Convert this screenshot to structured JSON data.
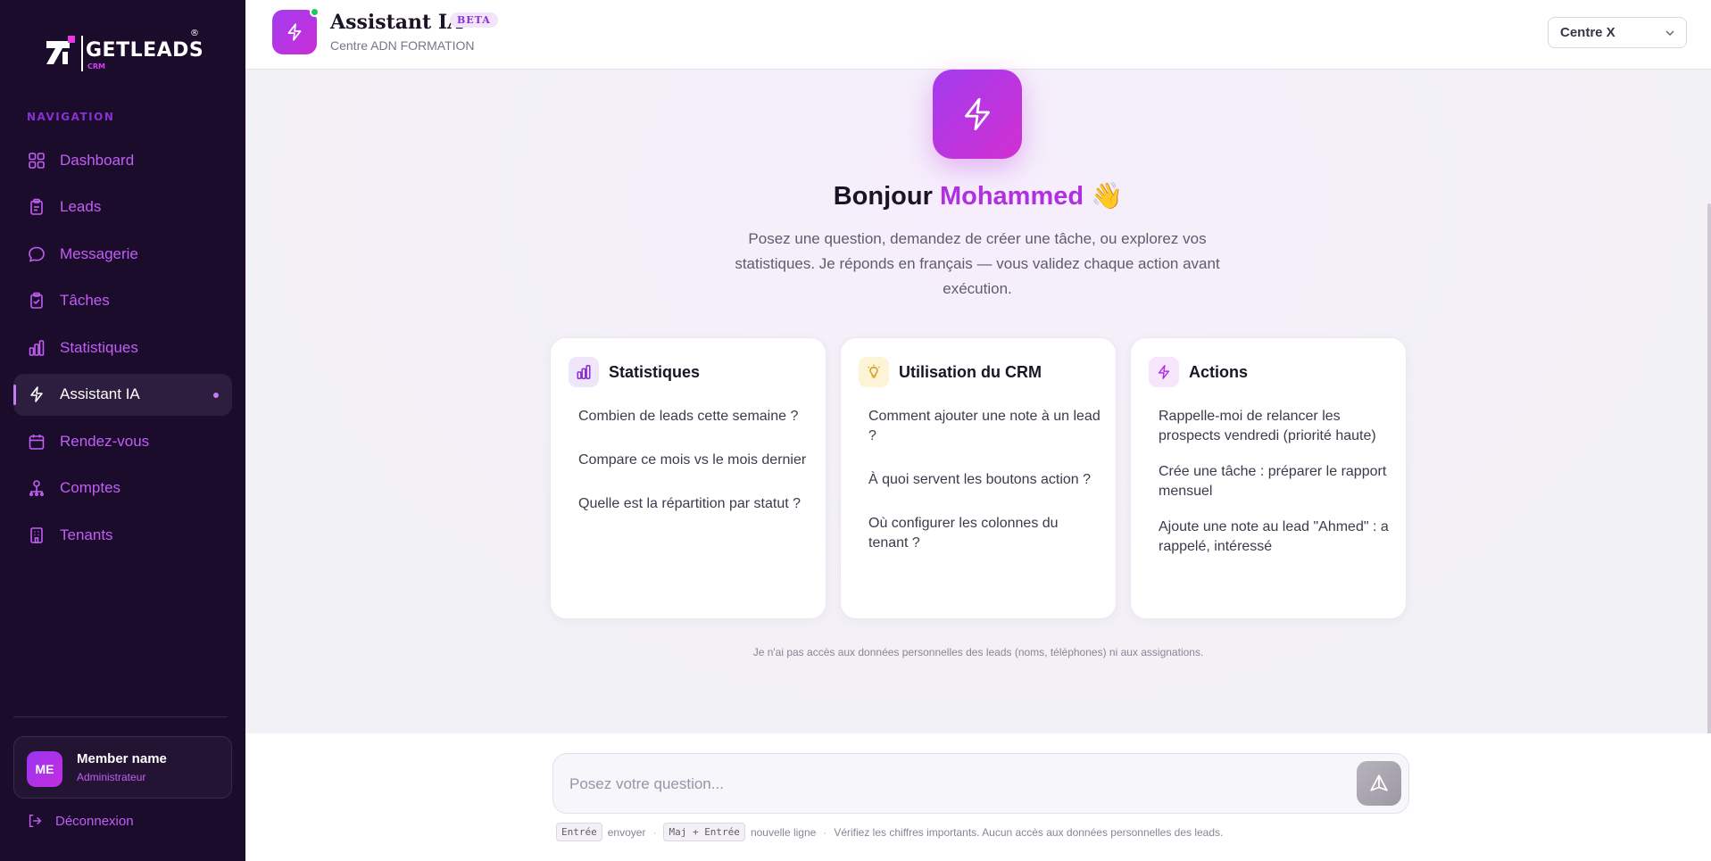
{
  "brand": {
    "name": "GETLEADS",
    "sub": "CRM",
    "registered": "®"
  },
  "sidebar": {
    "section_title": "NAVIGATION",
    "items": [
      {
        "label": "Dashboard",
        "icon": "grid-icon"
      },
      {
        "label": "Leads",
        "icon": "clipboard-icon"
      },
      {
        "label": "Messagerie",
        "icon": "chat-bubble-icon"
      },
      {
        "label": "Tâches",
        "icon": "clipboard-check-icon"
      },
      {
        "label": "Statistiques",
        "icon": "bar-chart-icon"
      },
      {
        "label": "Assistant IA",
        "icon": "lightning-icon",
        "active": true
      },
      {
        "label": "Rendez-vous",
        "icon": "calendar-icon"
      },
      {
        "label": "Comptes",
        "icon": "user-network-icon"
      },
      {
        "label": "Tenants",
        "icon": "building-icon"
      }
    ],
    "user": {
      "initials": "ME",
      "name": "Member name",
      "role": "Administrateur"
    },
    "logout_label": "Déconnexion"
  },
  "header": {
    "title": "Assistant IA",
    "badge": "BETA",
    "subtitle": "Centre ADN FORMATION",
    "center_select": "Centre X"
  },
  "main": {
    "greeting_prefix": "Bonjour",
    "greeting_name": "Mohammed",
    "greeting_emoji": "👋",
    "intro": "Posez une question, demandez de créer une tâche, ou explorez vos statistiques. Je réponds en français — vous validez chaque action avant exécution.",
    "cards": [
      {
        "title": "Statistiques",
        "icon": "bar-chart-icon",
        "questions": [
          "Combien de leads cette semaine ?",
          "Compare ce mois vs le mois dernier",
          "Quelle est la répartition par statut ?"
        ]
      },
      {
        "title": "Utilisation du CRM",
        "icon": "lightbulb-icon",
        "questions": [
          "Comment ajouter une note à un lead ?",
          "À quoi servent les boutons action ?",
          "Où configurer les colonnes du tenant ?"
        ]
      },
      {
        "title": "Actions",
        "icon": "lightning-icon",
        "questions": [
          "Rappelle-moi de relancer les prospects vendredi (priorité haute)",
          "Crée une tâche : préparer le rapport mensuel",
          "Ajoute une note au lead \"Ahmed\" : a rappelé, intéressé"
        ]
      }
    ],
    "disclaimer": "Je n'ai pas accès aux données personnelles des leads (noms, téléphones) ni aux assignations."
  },
  "composer": {
    "placeholder": "Posez votre question...",
    "hint_enter_key": "Entrée",
    "hint_enter_text": "envoyer",
    "hint_newline_key": "Maj + Entrée",
    "hint_newline_text": "nouvelle ligne",
    "hint_sep": "·",
    "hint_note": "Vérifiez les chiffres importants. Aucun accès aux données personnelles des leads."
  },
  "colors": {
    "sidebar_bg": "#1c0c2c",
    "accent": "#b02fe0",
    "nav_text": "#c15ef5",
    "online": "#22c55e"
  }
}
